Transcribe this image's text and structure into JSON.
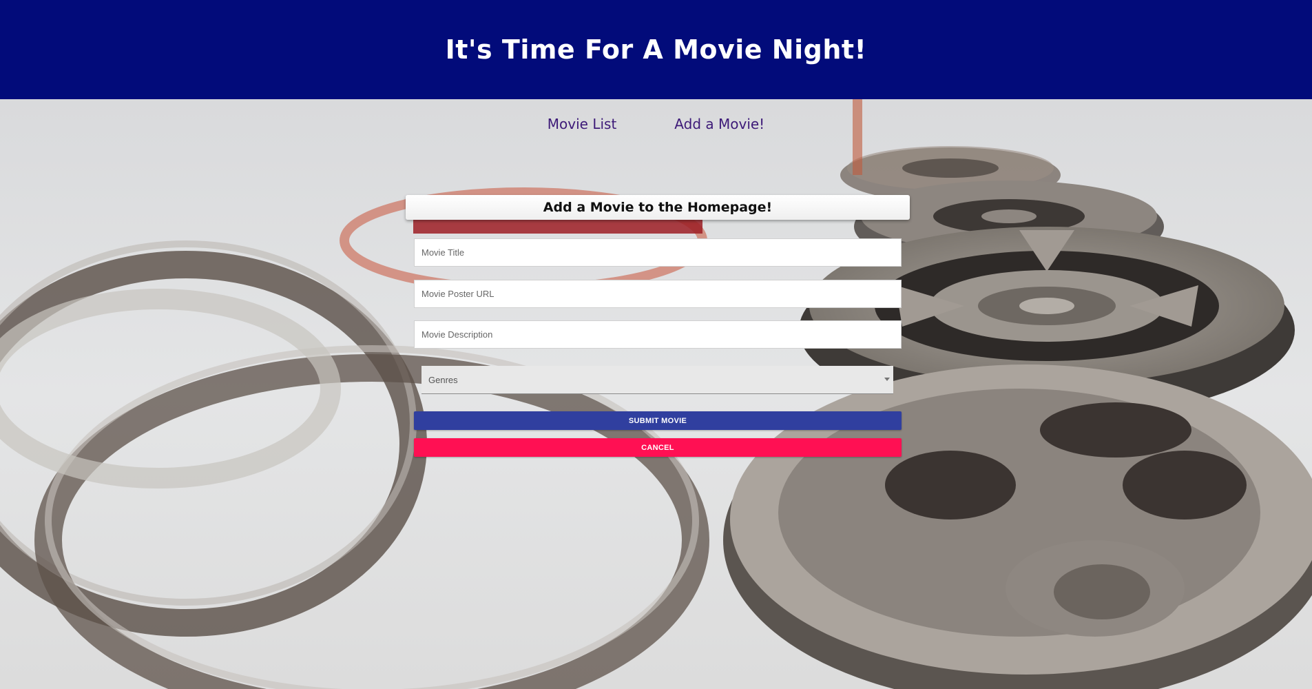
{
  "header": {
    "title": "It's Time For A Movie Night!"
  },
  "nav": {
    "movie_list": "Movie List",
    "add_movie": "Add a Movie!"
  },
  "form": {
    "title": "Add a Movie to the Homepage!",
    "movie_title_placeholder": "Movie Title",
    "poster_url_placeholder": "Movie Poster URL",
    "description_placeholder": "Movie Description",
    "genres_label": "Genres",
    "submit_label": "SUBMIT MOVIE",
    "cancel_label": "CANCEL"
  },
  "colors": {
    "header_bg": "#020b7a",
    "nav_link": "#3d1a78",
    "submit_bg": "#303f9f",
    "cancel_bg": "#ff1053"
  }
}
